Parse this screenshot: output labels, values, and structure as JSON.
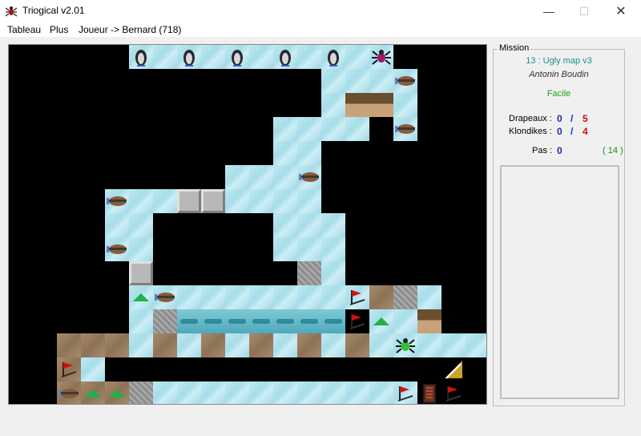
{
  "window": {
    "title": "Triogical v2.01",
    "minimize": "—",
    "maximize": "☐",
    "close": "✕"
  },
  "menu": {
    "items": [
      "Tableau",
      "Plus",
      "Joueur -> Bernard (718)"
    ]
  },
  "mission": {
    "legend": "Mission",
    "name": "13 : Ugly map v3",
    "author": "Antonin Boudin",
    "difficulty": "Facile",
    "flags_label": "Drapeaux :",
    "flags_value": "0",
    "flags_sep": "/",
    "flags_total": "5",
    "klondikes_label": "Klondikes :",
    "klondikes_value": "0",
    "klondikes_sep": "/",
    "klondikes_total": "4",
    "steps_label": "Pas :",
    "steps_value": "0",
    "steps_best": "( 14 )"
  },
  "colors": {
    "author_color": "#333333",
    "name_color": "#1e8c8c",
    "difficulty_color": "#1aa01a",
    "value_color": "#1a2fb0",
    "total_color": "#d01010",
    "best_color": "#1a8c1a"
  }
}
